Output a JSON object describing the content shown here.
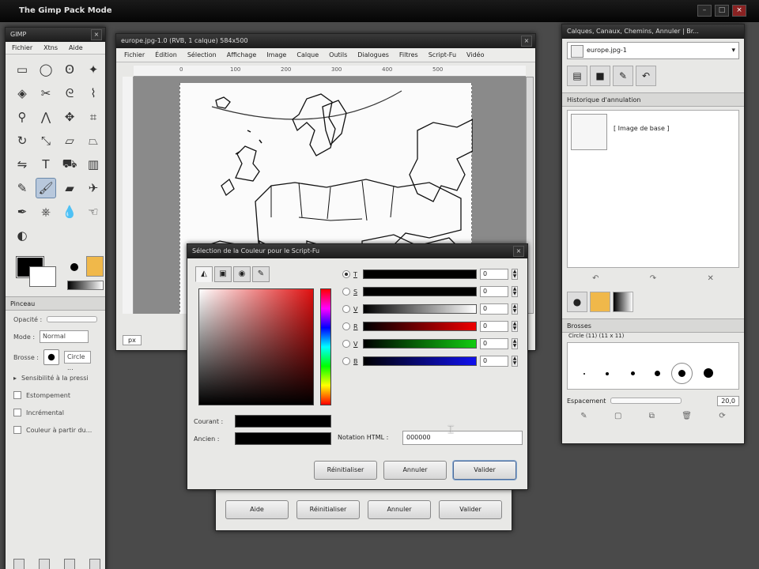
{
  "screen": {
    "title": "The Gimp Pack Mode",
    "controls": [
      "–",
      "□",
      "×"
    ]
  },
  "toolbox": {
    "title": "GIMP",
    "menu": [
      "Fichier",
      "Xtns",
      "Aide"
    ],
    "tools": [
      {
        "icon": "rect-select-icon",
        "glyph": "▭"
      },
      {
        "icon": "ellipse-select-icon",
        "glyph": "◯"
      },
      {
        "icon": "lasso-icon",
        "glyph": "ʘ"
      },
      {
        "icon": "fuzzy-select-icon",
        "glyph": "✦"
      },
      {
        "icon": "select-by-color-icon",
        "glyph": "◈"
      },
      {
        "icon": "scissors-icon",
        "glyph": "✂"
      },
      {
        "icon": "paths-icon",
        "glyph": "ᘓ"
      },
      {
        "icon": "color-picker-icon",
        "glyph": "⌇"
      },
      {
        "icon": "zoom-icon",
        "glyph": "⚲"
      },
      {
        "icon": "measure-icon",
        "glyph": "⋀"
      },
      {
        "icon": "move-icon",
        "glyph": "✥"
      },
      {
        "icon": "crop-icon",
        "glyph": "⌗"
      },
      {
        "icon": "rotate-icon",
        "glyph": "↻"
      },
      {
        "icon": "scale-icon",
        "glyph": "⤡"
      },
      {
        "icon": "shear-icon",
        "glyph": "▱"
      },
      {
        "icon": "perspective-icon",
        "glyph": "⏢"
      },
      {
        "icon": "flip-icon",
        "glyph": "⇋"
      },
      {
        "icon": "text-icon",
        "glyph": "T"
      },
      {
        "icon": "bucket-fill-icon",
        "glyph": "⛟"
      },
      {
        "icon": "blend-icon",
        "glyph": "▥"
      },
      {
        "icon": "pencil-icon",
        "glyph": "✎"
      },
      {
        "icon": "paintbrush-icon",
        "glyph": "🖌"
      },
      {
        "icon": "eraser-icon",
        "glyph": "▰"
      },
      {
        "icon": "airbrush-icon",
        "glyph": "✈"
      },
      {
        "icon": "ink-icon",
        "glyph": "✒"
      },
      {
        "icon": "clone-icon",
        "glyph": "⎈"
      },
      {
        "icon": "blur-icon",
        "glyph": "💧"
      },
      {
        "icon": "smudge-icon",
        "glyph": "☜"
      },
      {
        "icon": "dodge-burn-icon",
        "glyph": "◐"
      }
    ],
    "selected_tool": 21,
    "options": {
      "tab": "Pinceau",
      "opacity_label": "Opacité :",
      "mode_label": "Mode :",
      "mode_value": "Normal",
      "brush_label": "Brosse :",
      "brush_value": "Circle ...",
      "pressure_label": "Sensibilité à la pressi",
      "fade_label": "Estompement",
      "incremental_label": "Incrémental",
      "gradient_label": "Couleur à partir du..."
    }
  },
  "image_window": {
    "title": "europe.jpg-1.0 (RVB, 1 calque) 584x500",
    "menu": [
      "Fichier",
      "Édition",
      "Sélection",
      "Affichage",
      "Image",
      "Calque",
      "Outils",
      "Dialogues",
      "Filtres",
      "Script-Fu",
      "Vidéo"
    ],
    "ruler_ticks": [
      "0",
      "100",
      "200",
      "300",
      "400",
      "500"
    ],
    "unit": "px"
  },
  "dock": {
    "title": "Calques, Canaux, Chemins, Annuler | Br...",
    "image_select": "europe.jpg-1",
    "history_tab": "Historique d'annulation",
    "history_item": "[ Image de base ]",
    "brushes_tab": "Brosses",
    "brush_name": "Circle (11) (11 x 11)",
    "spacing_label": "Espacement",
    "spacing_value": "20,0"
  },
  "color_dialog": {
    "title": "Sélection de la Couleur pour le Script-Fu",
    "channels": [
      {
        "label": "T",
        "value": "0",
        "on": true,
        "gradient": "#000"
      },
      {
        "label": "S",
        "value": "0",
        "on": false,
        "gradient": "#000"
      },
      {
        "label": "V",
        "value": "0",
        "on": false,
        "gradient": "linear-gradient(90deg,#000,#fff)"
      },
      {
        "label": "R",
        "value": "0",
        "on": false,
        "gradient": "linear-gradient(90deg,#000,#e00)"
      },
      {
        "label": "V",
        "value": "0",
        "on": false,
        "gradient": "linear-gradient(90deg,#000,#1c1)"
      },
      {
        "label": "B",
        "value": "0",
        "on": false,
        "gradient": "linear-gradient(90deg,#000,#11e)"
      }
    ],
    "current_label": "Courant :",
    "old_label": "Ancien :",
    "hex_label": "Notation HTML :",
    "hex_value": "000000",
    "buttons": {
      "reset": "Réinitialiser",
      "cancel": "Annuler",
      "ok": "Valider"
    }
  },
  "scriptfu_dialog": {
    "buttons": {
      "help": "Aide",
      "reset": "Réinitialiser",
      "cancel": "Annuler",
      "ok": "Valider"
    }
  }
}
